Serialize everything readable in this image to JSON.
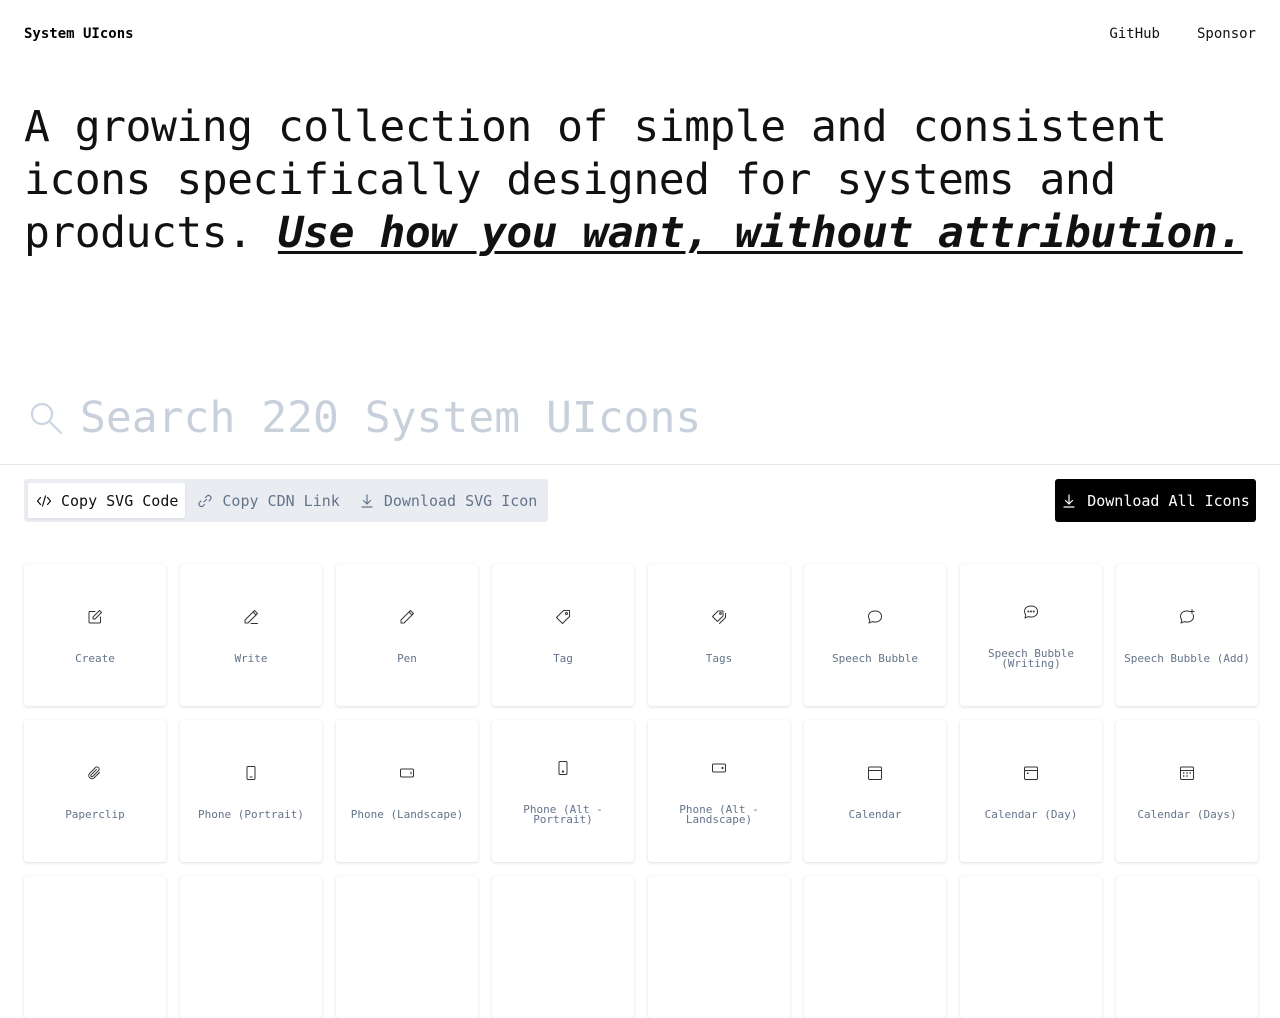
{
  "header": {
    "brand": "System UIcons",
    "nav": [
      "GitHub",
      "Sponsor"
    ]
  },
  "hero": {
    "text": "A growing collection of simple and consistent icons specifically designed for systems and products. ",
    "emphasis": "Use how you want, without attribution."
  },
  "search": {
    "placeholder": "Search 220 System UIcons"
  },
  "toolbar": {
    "modes": [
      {
        "label": "Copy SVG Code",
        "icon": "code-icon",
        "active": true
      },
      {
        "label": "Copy CDN Link",
        "icon": "link-icon",
        "active": false
      },
      {
        "label": "Download SVG Icon",
        "icon": "download-icon",
        "active": false
      }
    ],
    "download_all": "Download All Icons"
  },
  "icons": [
    {
      "label": "Create",
      "icon": "create-icon"
    },
    {
      "label": "Write",
      "icon": "write-icon"
    },
    {
      "label": "Pen",
      "icon": "pen-icon"
    },
    {
      "label": "Tag",
      "icon": "tag-icon"
    },
    {
      "label": "Tags",
      "icon": "tags-icon"
    },
    {
      "label": "Speech Bubble",
      "icon": "speech-bubble-icon"
    },
    {
      "label": "Speech Bubble (Writing)",
      "icon": "speech-bubble-writing-icon"
    },
    {
      "label": "Speech Bubble (Add)",
      "icon": "speech-bubble-add-icon"
    },
    {
      "label": "Paperclip",
      "icon": "paperclip-icon"
    },
    {
      "label": "Phone (Portrait)",
      "icon": "phone-portrait-icon"
    },
    {
      "label": "Phone (Landscape)",
      "icon": "phone-landscape-icon"
    },
    {
      "label": "Phone (Alt - Portrait)",
      "icon": "phone-alt-portrait-icon"
    },
    {
      "label": "Phone (Alt - Landscape)",
      "icon": "phone-alt-landscape-icon"
    },
    {
      "label": "Calendar",
      "icon": "calendar-icon"
    },
    {
      "label": "Calendar (Day)",
      "icon": "calendar-day-icon"
    },
    {
      "label": "Calendar (Days)",
      "icon": "calendar-days-icon"
    }
  ]
}
